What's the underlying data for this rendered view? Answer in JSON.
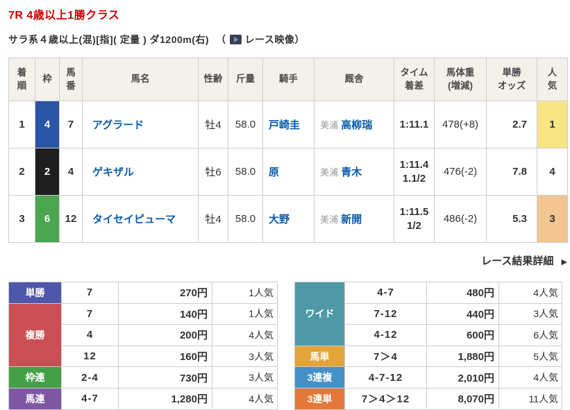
{
  "colors": {
    "title_red": "#cc0000",
    "link_blue": "#0a5bab",
    "table_header_bg": "#f4f1ea",
    "border_gray": "#cccccc",
    "ninki_first_bg": "#fae586",
    "ninki_third_bg": "#f2c591",
    "waku_blue": "#2a55a5",
    "waku_black": "#1e1e1e",
    "waku_green": "#4ba551"
  },
  "icons": {
    "video": "video-play-icon",
    "arrow_right": "▶"
  },
  "header": {
    "title": "7R 4歳以上1勝クラス",
    "conditions": "サラ系４歳以上(混)[指]( 定量 ) ダ1200m(右)",
    "paren_open": "（",
    "video_label": "レース映像",
    "paren_close": "）"
  },
  "results": {
    "columns": [
      "着\n順",
      "枠",
      "馬\n番",
      "馬名",
      "性齢",
      "斤量",
      "騎手",
      "厩舎",
      "タイム\n着差",
      "馬体重\n(増減)",
      "単勝\nオッズ",
      "人\n気"
    ],
    "rows": [
      {
        "rank": "1",
        "waku": "4",
        "waku_bg": "#2a55a5",
        "umaban": "7",
        "name": "アグラード",
        "sex_age": "牡4",
        "weight": "58.0",
        "jockey": "戸崎圭",
        "stable_area": "美浦",
        "trainer": "高柳瑞",
        "time": "1:11.1",
        "body_weight": "478(+8)",
        "odds": "2.7",
        "ninki": "1",
        "ninki_bg": "#fae586"
      },
      {
        "rank": "2",
        "waku": "2",
        "waku_bg": "#1e1e1e",
        "umaban": "4",
        "name": "ゲキザル",
        "sex_age": "牡6",
        "weight": "58.0",
        "jockey": "原",
        "stable_area": "美浦",
        "trainer": "青木",
        "time": "1:11.4\n1.1/2",
        "body_weight": "476(-2)",
        "odds": "7.8",
        "ninki": "4",
        "ninki_bg": "#ffffff"
      },
      {
        "rank": "3",
        "waku": "6",
        "waku_bg": "#4ba551",
        "umaban": "12",
        "name": "タイセイピューマ",
        "sex_age": "牡4",
        "weight": "58.0",
        "jockey": "大野",
        "stable_area": "美浦",
        "trainer": "新開",
        "time": "1:11.5\n1/2",
        "body_weight": "486(-2)",
        "odds": "5.3",
        "ninki": "3",
        "ninki_bg": "#f2c591"
      }
    ]
  },
  "detail_link": {
    "label": "レース結果詳細",
    "arrow": "▶"
  },
  "payouts_left": {
    "rows": [
      {
        "type": "単勝",
        "color": "#4e57a9",
        "entries": [
          {
            "comb": "7",
            "payout": "270円",
            "ninki": "1人気"
          }
        ]
      },
      {
        "type": "複勝",
        "color": "#c94f55",
        "entries": [
          {
            "comb": "7",
            "payout": "140円",
            "ninki": "1人気"
          },
          {
            "comb": "4",
            "payout": "200円",
            "ninki": "4人気"
          },
          {
            "comb": "12",
            "payout": "160円",
            "ninki": "3人気"
          }
        ]
      },
      {
        "type": "枠連",
        "color": "#43a047",
        "entries": [
          {
            "comb": "2-4",
            "payout": "730円",
            "ninki": "3人気"
          }
        ]
      },
      {
        "type": "馬連",
        "color": "#7e57a5",
        "entries": [
          {
            "comb": "4-7",
            "payout": "1,280円",
            "ninki": "4人気"
          }
        ]
      }
    ]
  },
  "payouts_right": {
    "rows": [
      {
        "type": "ワイド",
        "color": "#4f99a6",
        "entries": [
          {
            "comb": "4-7",
            "payout": "480円",
            "ninki": "4人気"
          },
          {
            "comb": "7-12",
            "payout": "440円",
            "ninki": "3人気"
          },
          {
            "comb": "4-12",
            "payout": "600円",
            "ninki": "6人気"
          }
        ]
      },
      {
        "type": "馬単",
        "color": "#e3a43a",
        "entries": [
          {
            "comb": "7＞4",
            "payout": "1,880円",
            "ninki": "5人気"
          }
        ]
      },
      {
        "type": "3連複",
        "color": "#4690c8",
        "entries": [
          {
            "comb": "4-7-12",
            "payout": "2,010円",
            "ninki": "4人気"
          }
        ]
      },
      {
        "type": "3連単",
        "color": "#e3783a",
        "entries": [
          {
            "comb": "7＞4＞12",
            "payout": "8,070円",
            "ninki": "11人気"
          }
        ]
      }
    ]
  }
}
